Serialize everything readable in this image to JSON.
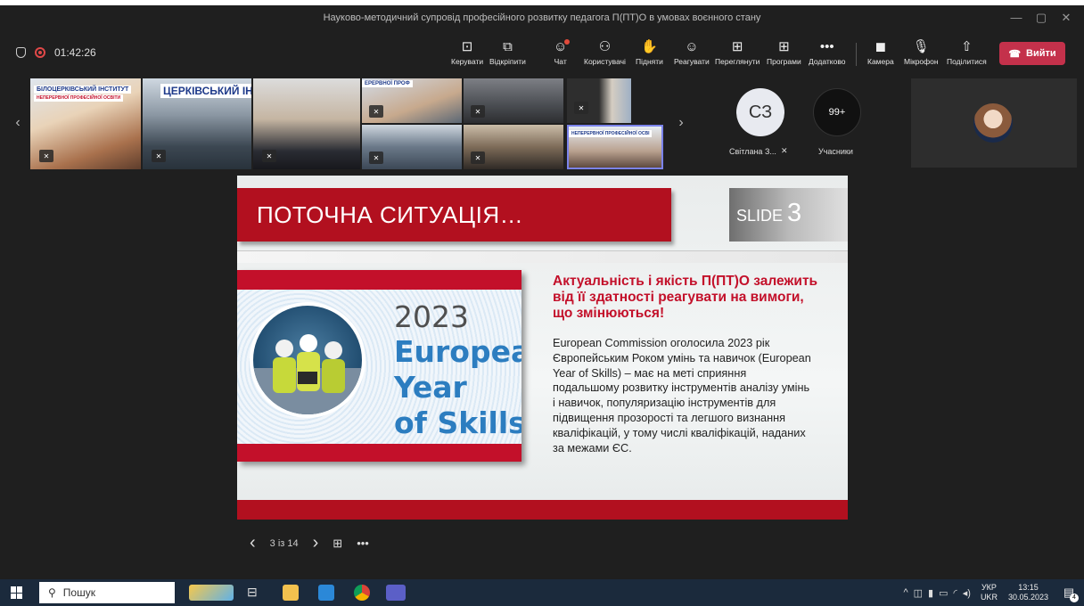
{
  "window": {
    "title": "Науково-методичний супровід професійного розвитку педагога П(ПТ)О в умовах воєнного стану",
    "min": "—",
    "max": "▢",
    "close": "✕"
  },
  "meeting": {
    "timer": "01:42:26"
  },
  "toolbar": {
    "buttons": [
      {
        "label": "Керувати",
        "icon": "present-icon",
        "glyph": "⊡"
      },
      {
        "label": "Відкріпити",
        "icon": "unpin-icon",
        "glyph": "⧉"
      },
      {
        "label": "Чат",
        "icon": "chat-icon",
        "glyph": "☺"
      },
      {
        "label": "Користувачі",
        "icon": "people-icon",
        "glyph": "⚇"
      },
      {
        "label": "Підняти",
        "icon": "raise-hand-icon",
        "glyph": "✋"
      },
      {
        "label": "Реагувати",
        "icon": "react-icon",
        "glyph": "☺"
      },
      {
        "label": "Переглянути",
        "icon": "view-icon",
        "glyph": "⊞"
      },
      {
        "label": "Програми",
        "icon": "apps-icon",
        "glyph": "⊞"
      },
      {
        "label": "Додатково",
        "icon": "more-icon",
        "glyph": "•••"
      },
      {
        "label": "Камера",
        "icon": "camera-off-icon",
        "glyph": "◼"
      },
      {
        "label": "Мікрофон",
        "icon": "mic-off-icon",
        "glyph": "🎙"
      },
      {
        "label": "Поділитися",
        "icon": "share-icon",
        "glyph": "⇧"
      }
    ],
    "leave_label": "Вийти"
  },
  "participants": {
    "tile_banners": [
      "БІЛОЦЕРКІВСЬКИЙ ІНСТИТУТ",
      "НЕПЕРЕРВНОЇ ПРОФЕСІЙНОЇ ОСВІТИ",
      "ЦЕРКІВСЬКИЙ ІНСТ",
      "ЕРЕРВНОЇ ПРОФ",
      "НЕПЕРЕРВНОЇ ПРОФЕСІЙНОЇ ОСВІ"
    ],
    "avatar_initials": "СЗ",
    "avatar_name": "Світлана З...",
    "more_count": "99+",
    "more_label": "Учасники"
  },
  "slide": {
    "title": "ПОТОЧНА СИТУАЦІЯ…",
    "slide_label": "SLIDE",
    "slide_number": "3",
    "poster": {
      "year": "2023",
      "line1": "European",
      "line2": "Year",
      "line3": "of Skills"
    },
    "heading": "Актуальність і якість П(ПТ)О залежить від її здатності реагувати на вимоги, що змінюються!",
    "body": "European Commission оголосила 2023 рік Європейським Роком умінь та навичок (European Year of Skills) – має на меті сприяння подальшому розвитку інструментів аналізу умінь і навичок, популяризацію інструментів для підвищення прозорості та легшого визнання кваліфікацій, у тому числі кваліфікацій, наданих за межами ЄС.",
    "colors": {
      "accent_red": "#b2101f",
      "heading_red": "#c3102a",
      "poster_blue": "#2c7dc0"
    }
  },
  "slide_nav": {
    "prev": "‹",
    "page": "3 із 14",
    "next": "›",
    "grid": "⊞",
    "more": "•••"
  },
  "taskbar": {
    "search_placeholder": "Пошук",
    "lang_top": "УКР",
    "lang_bottom": "UKR",
    "time": "13:15",
    "date": "30.05.2023",
    "notif_count": "4"
  }
}
